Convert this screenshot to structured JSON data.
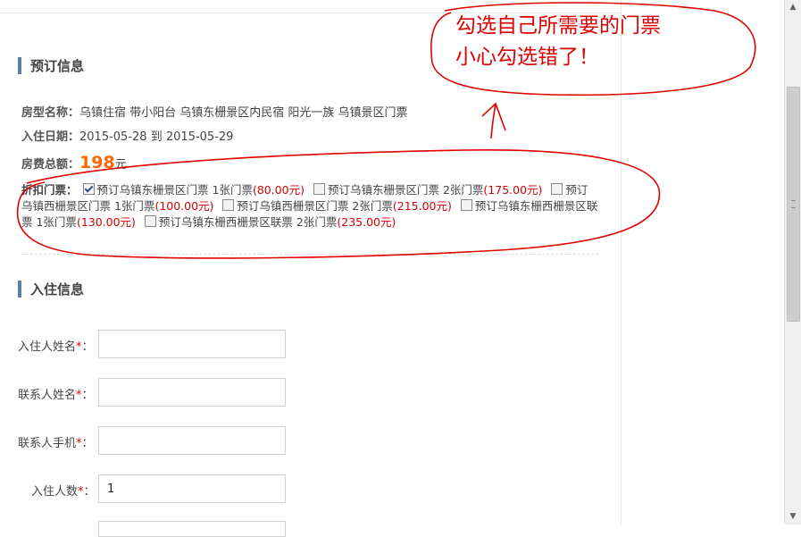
{
  "booking": {
    "title": "预订信息",
    "room_label": "房型名称：",
    "room_value": "乌镇住宿 带小阳台 乌镇东栅景区内民宿 阳光一族 乌镇景区门票",
    "date_label": "入住日期：",
    "date_value": "2015-05-28 到 2015-05-29",
    "total_label": "房费总额：",
    "total_amount": "198",
    "total_unit": "元",
    "ticket_label": "折扣门票："
  },
  "tickets": [
    {
      "text": "预订乌镇东栅景区门票 1张门票",
      "price": "(80.00元)",
      "checked": true
    },
    {
      "text": "预订乌镇东栅景区门票 2张门票",
      "price": "(175.00元)",
      "checked": false
    },
    {
      "text": "预订乌镇西栅景区门票 1张门票",
      "price": "(100.00元)",
      "checked": false
    },
    {
      "text": "预订乌镇西栅景区门票 2张门票",
      "price": "(215.00元)",
      "checked": false
    },
    {
      "text": "预订乌镇东栅西栅景区联票 1张门票",
      "price": "(130.00元)",
      "checked": false
    },
    {
      "text": "预订乌镇东栅西栅景区联票 2张门票",
      "price": "(235.00元)",
      "checked": false
    }
  ],
  "guest": {
    "title": "入住信息",
    "name_label": "入住人姓名",
    "contact_label": "联系人姓名",
    "phone_label": "联系人手机",
    "count_label": "入住人数",
    "required_mark": "*",
    "colon": "：",
    "count_value": "1"
  },
  "annotation": {
    "line1": "勾选自己所需要的门票",
    "line2": "小心勾选错了！",
    "color": "#e10000"
  },
  "colors": {
    "accent_bar": "#5b7fa6",
    "price_red": "#d40000",
    "total_orange": "#ff6600"
  }
}
